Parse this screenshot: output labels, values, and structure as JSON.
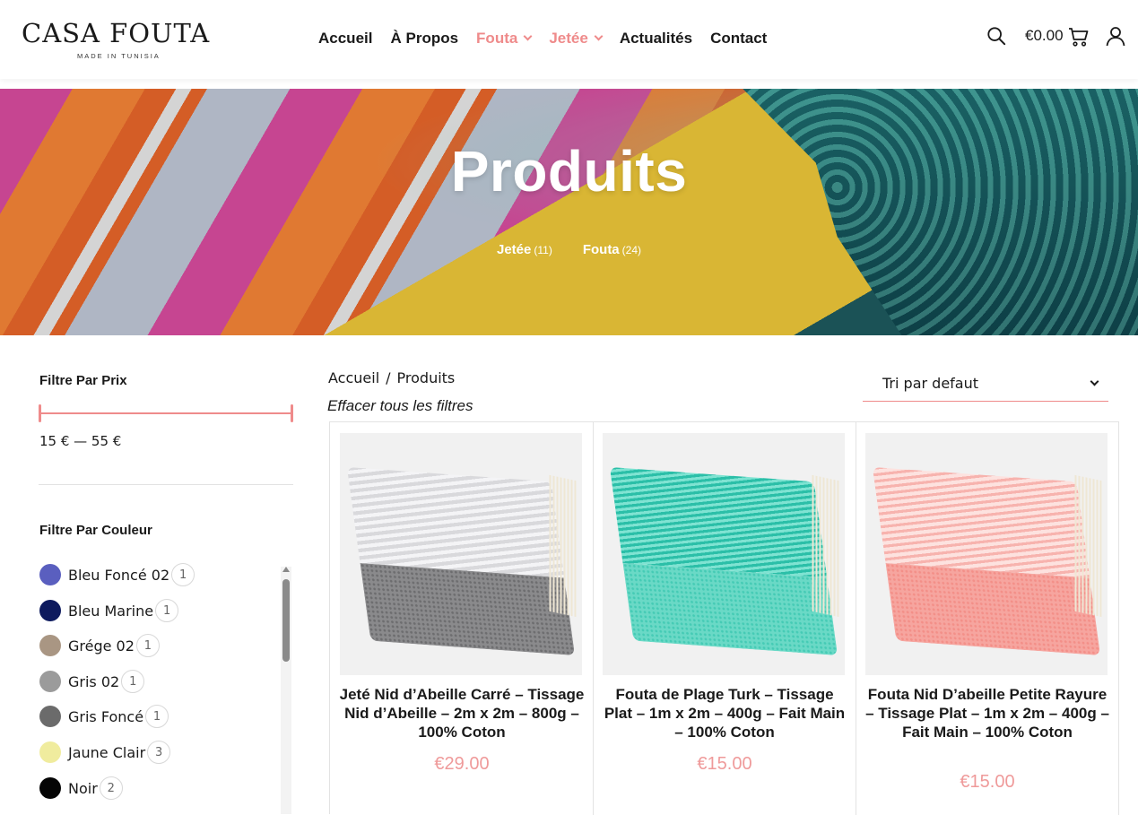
{
  "header": {
    "logo_main": "CASA FOUTA",
    "logo_sub": "MADE IN TUNISIA",
    "nav": [
      {
        "label": "Accueil",
        "accent": false,
        "dropdown": false
      },
      {
        "label": "À Propos",
        "accent": false,
        "dropdown": false
      },
      {
        "label": "Fouta",
        "accent": true,
        "dropdown": true
      },
      {
        "label": "Jetée",
        "accent": true,
        "dropdown": true
      },
      {
        "label": "Actualités",
        "accent": false,
        "dropdown": false
      },
      {
        "label": "Contact",
        "accent": false,
        "dropdown": false
      }
    ],
    "cart_amount": "€0.00",
    "icons": {
      "search": "search-icon",
      "cart": "cart-icon",
      "account": "user-icon"
    }
  },
  "hero": {
    "title": "Produits",
    "categories": [
      {
        "label": "Jetée",
        "count": "(11)"
      },
      {
        "label": "Fouta",
        "count": "(24)"
      }
    ]
  },
  "sidebar": {
    "price_filter_title": "Filtre Par Prix",
    "price_range": "15 € — 55 €",
    "color_filter_title": "Filtre Par Couleur",
    "colors": [
      {
        "label": "Bleu Foncé 02",
        "count": "1",
        "hex": "#5a5fbf"
      },
      {
        "label": "Bleu Marine",
        "count": "1",
        "hex": "#0d1a5e"
      },
      {
        "label": "Grége 02",
        "count": "1",
        "hex": "#a99683"
      },
      {
        "label": "Gris 02",
        "count": "1",
        "hex": "#9b9b9b"
      },
      {
        "label": "Gris Foncé",
        "count": "1",
        "hex": "#6b6b6b"
      },
      {
        "label": "Jaune Clair",
        "count": "3",
        "hex": "#f0ec9e"
      },
      {
        "label": "Noir",
        "count": "2",
        "hex": "#050505"
      }
    ]
  },
  "main": {
    "breadcrumb": {
      "home": "Accueil",
      "separator": "/",
      "current": "Produits"
    },
    "clear_filters": "Effacer tous les filtres",
    "sort_selected": "Tri par defaut",
    "products": [
      {
        "title": "Jeté Nid d’Abeille Carré – Tissage Nid d’Abeille – 2m x 2m – 800g – 100% Coton",
        "price": "€29.00",
        "color": "gray"
      },
      {
        "title": "Fouta de Plage Turk – Tissage Plat – 1m x 2m – 400g – Fait Main – 100% Coton",
        "price": "€15.00",
        "color": "turquoise"
      },
      {
        "title": "Fouta Nid D’abeille Petite Rayure – Tissage Plat – 1m x 2m – 400g – Fait Main – 100% Coton",
        "price": "€15.00",
        "color": "pink"
      }
    ]
  },
  "colors": {
    "accent": "#ef8b8b",
    "price": "#ef9a9a",
    "text": "#1a1a1a"
  }
}
